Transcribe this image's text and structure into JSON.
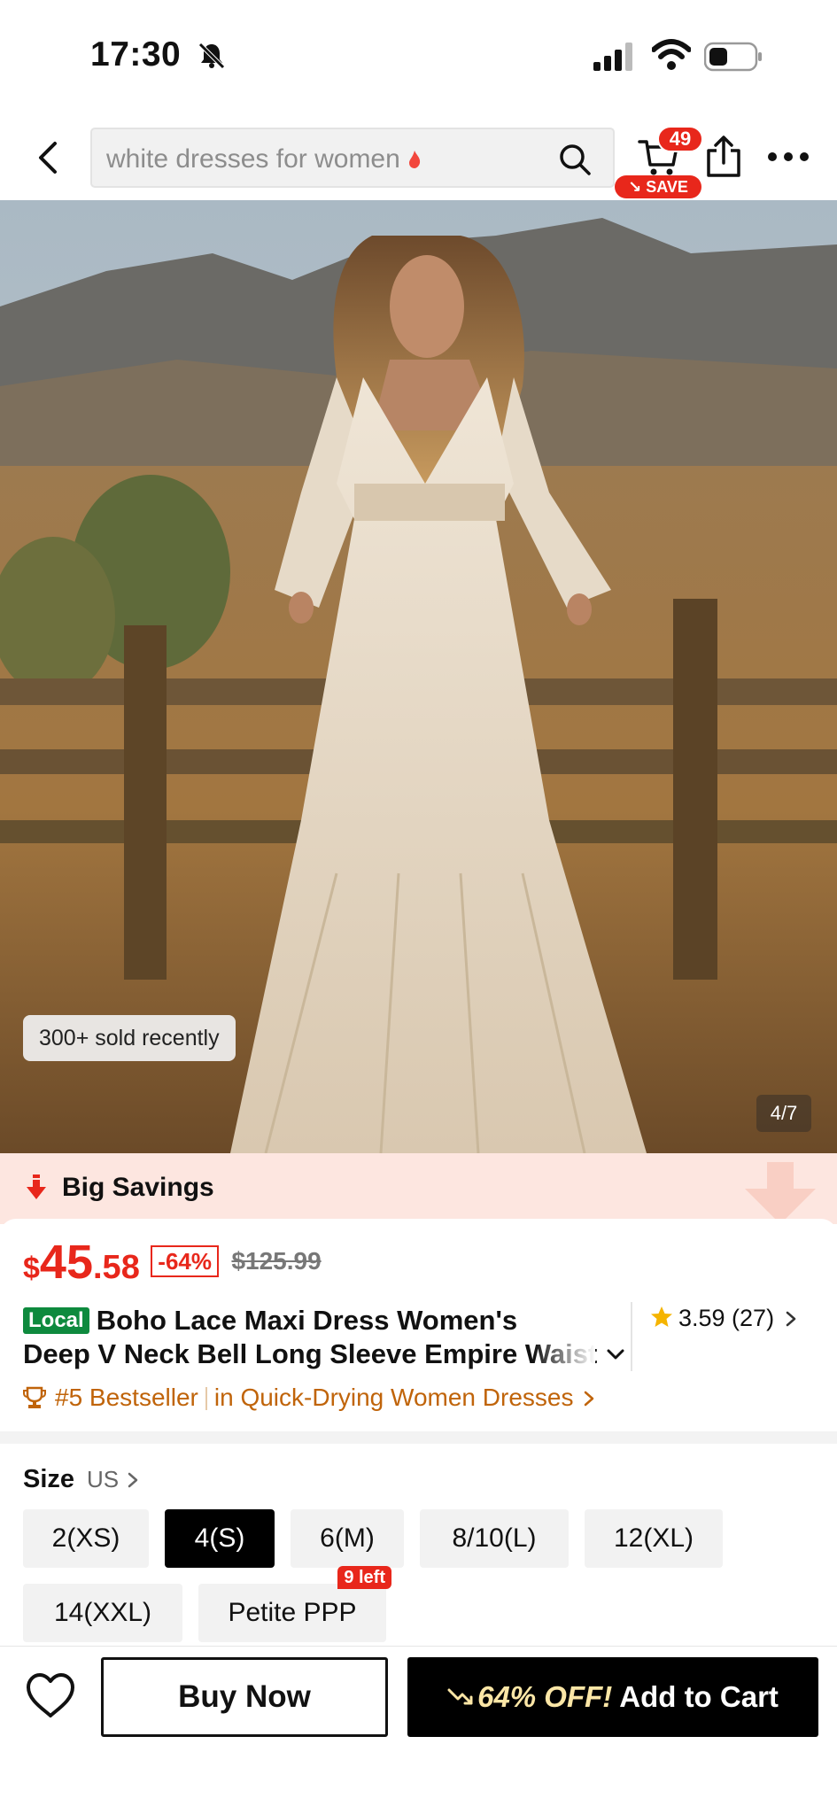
{
  "status_bar": {
    "time": "17:30",
    "icons": [
      "bell-slash-icon",
      "cellular-signal-icon",
      "wifi-icon",
      "battery-icon"
    ]
  },
  "nav": {
    "search_text": "white dresses for women",
    "cart_count": "49",
    "save_label": "SAVE"
  },
  "hero": {
    "sold_badge": "300+ sold recently",
    "image_counter": "4/7"
  },
  "savings": {
    "label": "Big Savings"
  },
  "product": {
    "price_currency": "$",
    "price_main": "45",
    "price_cents": ".58",
    "discount": "-64%",
    "original_price": "$125.99",
    "local_badge": "Local",
    "title_line1": "Boho Lace Maxi Dress Women's",
    "title_line2": "Deep V Neck Bell Long Sleeve Empire Waist",
    "rating": "3.59 (27)",
    "bestseller_rank": "#5 Bestseller",
    "bestseller_category": "in Quick-Drying Women Dresses"
  },
  "size": {
    "label": "Size",
    "unit": "US",
    "options": [
      "2(XS)",
      "4(S)",
      "6(M)",
      "8/10(L)",
      "12(XL)",
      "14(XXL)",
      "Petite PPP"
    ],
    "selected": "4(S)",
    "stock_tag": "9 left"
  },
  "actions": {
    "buy_now": "Buy Now",
    "off_label": "64% OFF!",
    "add_to_cart": "Add to Cart"
  },
  "colors": {
    "accent_red": "#e8271b",
    "local_green": "#0e8a3e",
    "bestseller_orange": "#c0640a",
    "savings_band": "#fde6e0"
  }
}
